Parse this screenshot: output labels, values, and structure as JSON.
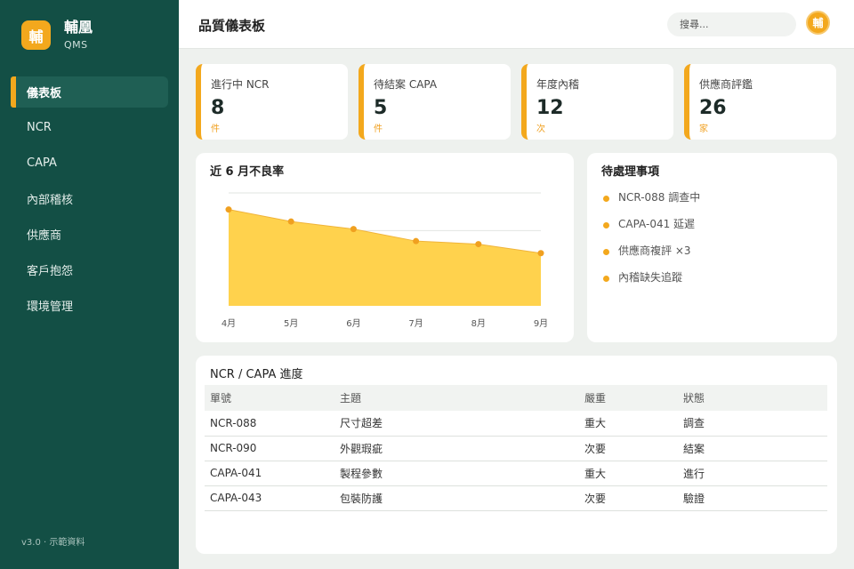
{
  "brand": {
    "logo_char": "輔",
    "name": "輔凰",
    "sub": "QMS",
    "accent": "#f3a81d"
  },
  "nav": [
    {
      "label": "儀表板",
      "active": true
    },
    {
      "label": "NCR"
    },
    {
      "label": "CAPA"
    },
    {
      "label": "內部稽核"
    },
    {
      "label": "供應商"
    },
    {
      "label": "客戶抱怨"
    },
    {
      "label": "環境管理"
    }
  ],
  "version": "v3.0 · 示範資料",
  "header": {
    "title": "品質儀表板",
    "search_placeholder": "搜尋...",
    "avatar_char": "輔"
  },
  "kpis": [
    {
      "label": "進行中 NCR",
      "value": "8",
      "unit": "件"
    },
    {
      "label": "待結案 CAPA",
      "value": "5",
      "unit": "件"
    },
    {
      "label": "年度內稽",
      "value": "12",
      "unit": "次"
    },
    {
      "label": "供應商評鑑",
      "value": "26",
      "unit": "家"
    }
  ],
  "chart_panel": {
    "title": "近 6 月不良率"
  },
  "chart_data": {
    "type": "area",
    "categories": [
      "4月",
      "5月",
      "6月",
      "7月",
      "8月",
      "9月"
    ],
    "values": [
      3.2,
      2.8,
      2.55,
      2.15,
      2.05,
      1.75
    ],
    "ylim": [
      0,
      3.75
    ],
    "grid": true,
    "color": "#ffd24d"
  },
  "todo": {
    "title": "待處理事項",
    "items": [
      "NCR-088 調查中",
      "CAPA-041 延遲",
      "供應商複評 ×3",
      "內稽缺失追蹤"
    ]
  },
  "table": {
    "title": "NCR / CAPA 進度",
    "headers": [
      "單號",
      "主題",
      "嚴重",
      "狀態"
    ],
    "rows": [
      [
        "NCR-088",
        "尺寸超差",
        "重大",
        "調查"
      ],
      [
        "NCR-090",
        "外觀瑕疵",
        "次要",
        "結案"
      ],
      [
        "CAPA-041",
        "製程參數",
        "重大",
        "進行"
      ],
      [
        "CAPA-043",
        "包裝防護",
        "次要",
        "驗證"
      ]
    ]
  }
}
